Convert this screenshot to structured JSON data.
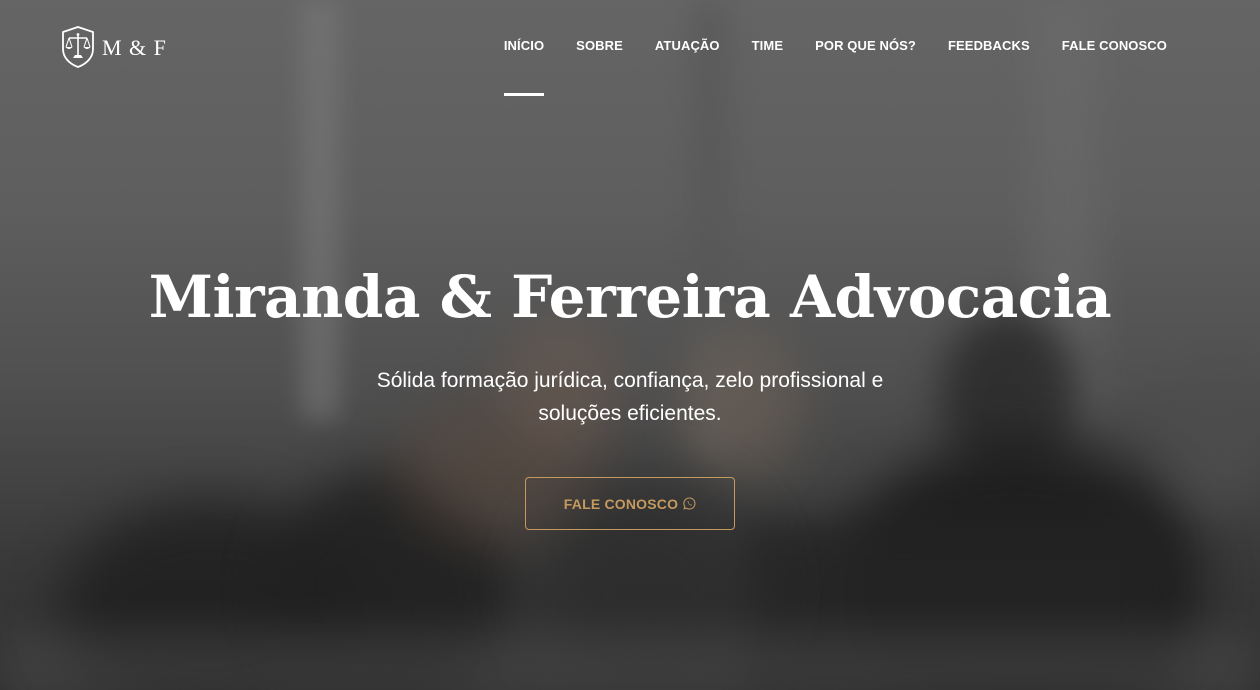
{
  "brand": {
    "logo_text": "M & F",
    "logo_icon": "scales-of-justice-shield-icon"
  },
  "nav": {
    "items": [
      {
        "label": "INÍCIO",
        "active": true
      },
      {
        "label": "SOBRE",
        "active": false
      },
      {
        "label": "ATUAÇÃO",
        "active": false
      },
      {
        "label": "TIME",
        "active": false
      },
      {
        "label": "POR QUE NÓS?",
        "active": false
      },
      {
        "label": "FEEDBACKS",
        "active": false
      },
      {
        "label": "FALE CONOSCO",
        "active": false
      }
    ]
  },
  "hero": {
    "title": "Miranda & Ferreira Advocacia",
    "subtitle": "Sólida formação jurídica, confiança, zelo profissional e soluções eficientes.",
    "cta_label": "FALE CONOSCO",
    "cta_icon": "whatsapp-icon"
  },
  "colors": {
    "accent": "#c49a5f",
    "text": "#ffffff"
  }
}
